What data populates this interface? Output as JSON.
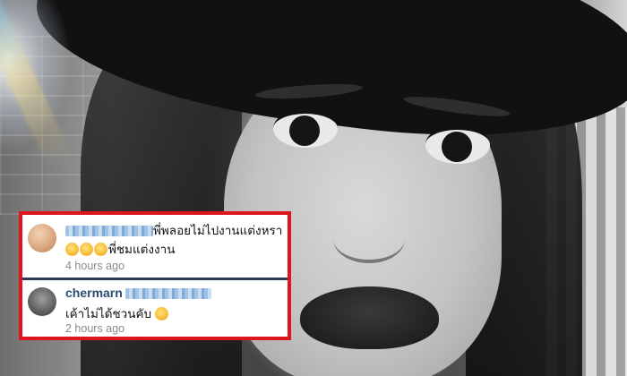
{
  "comments": [
    {
      "text_line1": "พี่พลอยไม่ไปงานแต่งหรา",
      "text_line2": "พี่ชมแต่งงาน",
      "time": "4 hours ago"
    },
    {
      "username": "chermarn",
      "text": "เค้าไม่ได้ชวนคับ",
      "time": "2 hours ago"
    }
  ],
  "colors": {
    "frame": "#e0141e",
    "username": "#2b4a74",
    "time": "#8a8a8a"
  },
  "icons": [
    "avatar-1",
    "avatar-2",
    "grin-emoji",
    "smiling-emoji"
  ]
}
